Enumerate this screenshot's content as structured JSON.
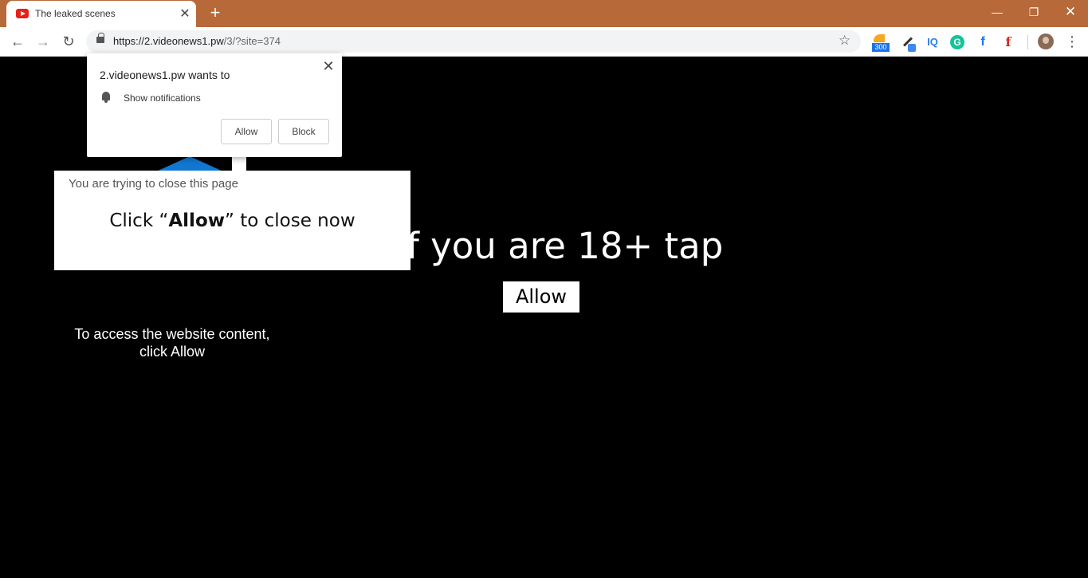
{
  "browser": {
    "tab_title": "The leaked scenes",
    "new_tab_symbol": "+",
    "url_host": "https://2.videonews1.pw",
    "url_path": "/3/?site=374",
    "extensions": {
      "rss_badge": "300",
      "iq_label": "IQ",
      "grammarly_label": "G",
      "facebook_label": "f",
      "flipboard_label": "f"
    }
  },
  "notification_prompt": {
    "title": "2.videonews1.pw wants to",
    "permission": "Show notifications",
    "allow_label": "Allow",
    "block_label": "Block"
  },
  "close_overlay": {
    "notice": "You are trying to close this page",
    "cta_prefix": "Click “",
    "cta_bold": "Allow",
    "cta_suffix": "” to close now"
  },
  "page": {
    "heading": "f you are 18+ tap",
    "allow_button": "Allow",
    "access_line1": "To access the website content,",
    "access_line2": "click Allow"
  },
  "colors": {
    "titlebar": "#b7693a",
    "accent_blue": "#1177d1"
  }
}
